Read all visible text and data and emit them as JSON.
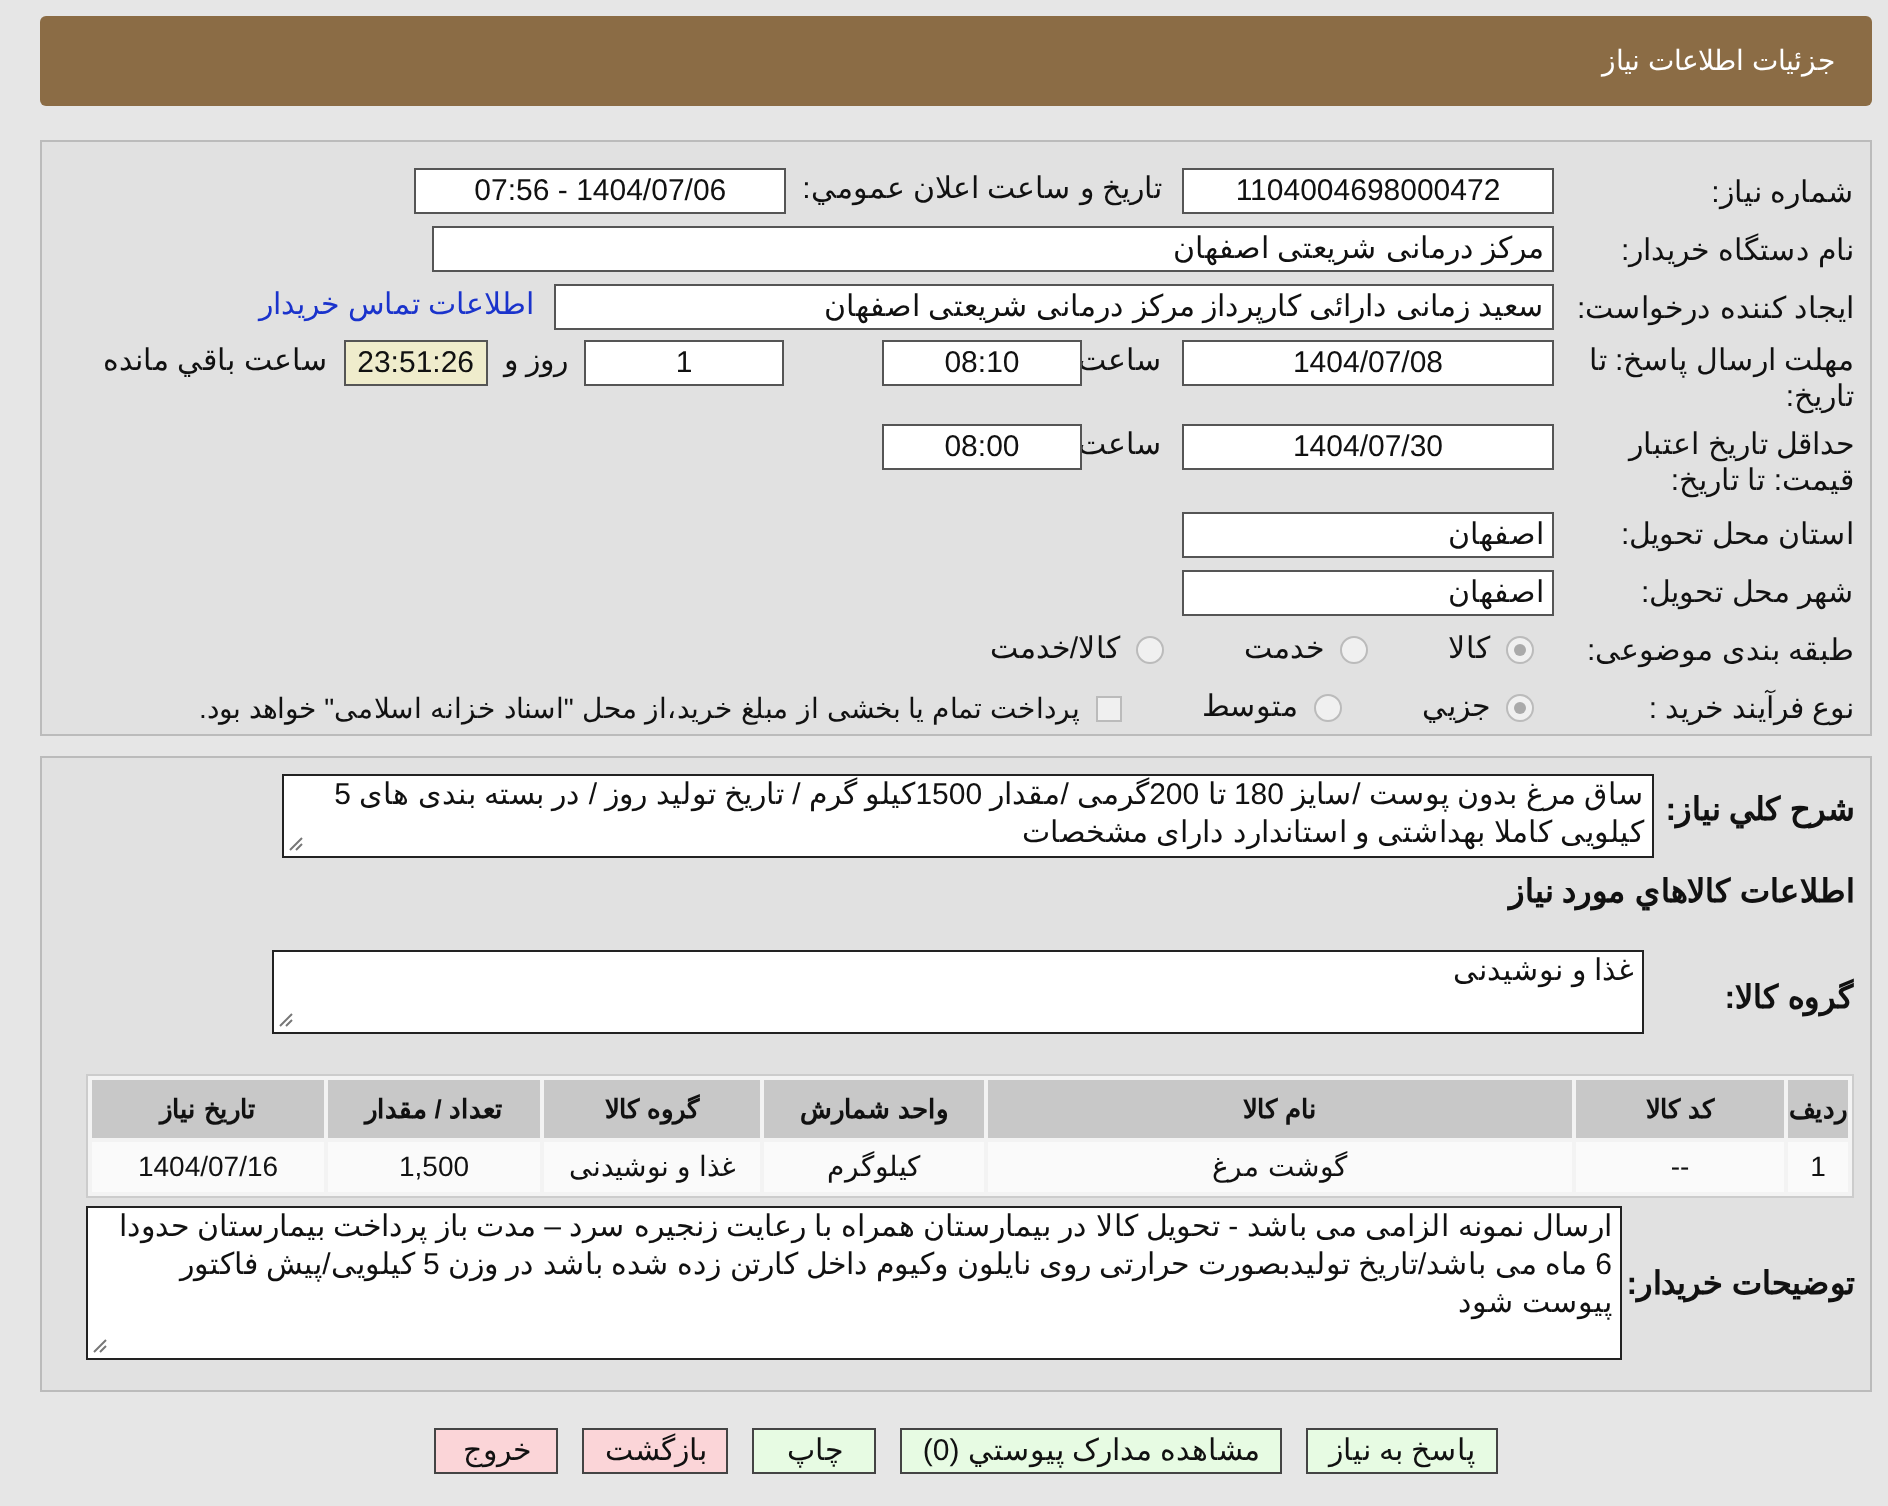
{
  "header": {
    "title": "جزئیات اطلاعات نیاز"
  },
  "details": {
    "need_number": {
      "label": "شماره نیاز:",
      "value": "1104004698000472"
    },
    "announce": {
      "label": "تاریخ و ساعت اعلان عمومي:",
      "value": "1404/07/06 - 07:56"
    },
    "buyer": {
      "label": "نام دستگاه خریدار:",
      "value": "مرکز درمانی شریعتی اصفهان"
    },
    "creator": {
      "label": "ایجاد کننده درخواست:",
      "value": "سعید زمانی دارائی کارپرداز مرکز درمانی شریعتی اصفهان",
      "link": "اطلاعات تماس خریدار"
    },
    "deadline": {
      "label": "مهلت ارسال پاسخ: تا تاریخ:",
      "date": "1404/07/08",
      "time_label": "ساعت",
      "time": "08:10",
      "days": "1",
      "days_label": "روز و",
      "remaining": "23:51:26",
      "remaining_label": "ساعت باقي مانده"
    },
    "validity": {
      "label": "حداقل تاریخ اعتبار قیمت: تا تاریخ:",
      "date": "1404/07/30",
      "time_label": "ساعت",
      "time": "08:00"
    },
    "province": {
      "label": "استان محل تحویل:",
      "value": "اصفهان"
    },
    "city": {
      "label": "شهر محل تحویل:",
      "value": "اصفهان"
    },
    "category": {
      "label": "طبقه بندی موضوعی:",
      "options": [
        {
          "label": "کالا",
          "selected": true
        },
        {
          "label": "خدمت",
          "selected": false
        },
        {
          "label": "کالا/خدمت",
          "selected": false
        }
      ]
    },
    "process": {
      "label": "نوع فرآیند خرید :",
      "options": [
        {
          "label": "جزيي",
          "selected": true
        },
        {
          "label": "متوسط",
          "selected": false
        }
      ],
      "payment": {
        "label": "پرداخت تمام یا بخشی از مبلغ خرید،از محل \"اسناد خزانه اسلامی\" خواهد بود.",
        "checked": false
      }
    }
  },
  "summary": {
    "label": "شرح کلي نیاز:",
    "value": "ساق مرغ بدون پوست /سایز 180 تا 200گرمی /مقدار 1500کیلو گرم / تاریخ تولید روز / در بسته بندی های 5 کیلویی کاملا بهداشتی و استاندارد دارای مشخصات"
  },
  "goods_heading": "اطلاعات کالاهاي مورد نیاز",
  "goods_group": {
    "label": "گروه کالا:",
    "value": "غذا و نوشیدنی"
  },
  "table": {
    "columns": [
      "ردیف",
      "کد کالا",
      "نام کالا",
      "واحد شمارش",
      "گروه کالا",
      "تعداد / مقدار",
      "تاریخ نیاز"
    ],
    "rows": [
      [
        "1",
        "--",
        "گوشت مرغ",
        "کیلوگرم",
        "غذا و نوشیدنی",
        "1,500",
        "1404/07/16"
      ]
    ]
  },
  "remarks": {
    "label": "توضیحات خریدار:",
    "value": "ارسال نمونه الزامی می باشد - تحویل کالا در بیمارستان همراه با رعایت زنجیره سرد – مدت باز پرداخت بیمارستان حدودا  6 ماه می باشد/تاریخ تولیدبصورت حرارتی روی نایلون وکیوم داخل کارتن زده شده باشد در وزن 5 کیلویی/پیش فاکتور پیوست شود"
  },
  "buttons": [
    {
      "label": "پاسخ به نیاز",
      "kind": "normal"
    },
    {
      "label": "مشاهده مدارک پیوستي (0)",
      "kind": "normal"
    },
    {
      "label": "چاپ",
      "kind": "normal"
    },
    {
      "label": "بازگشت",
      "kind": "danger"
    },
    {
      "label": "خروج",
      "kind": "danger"
    }
  ]
}
